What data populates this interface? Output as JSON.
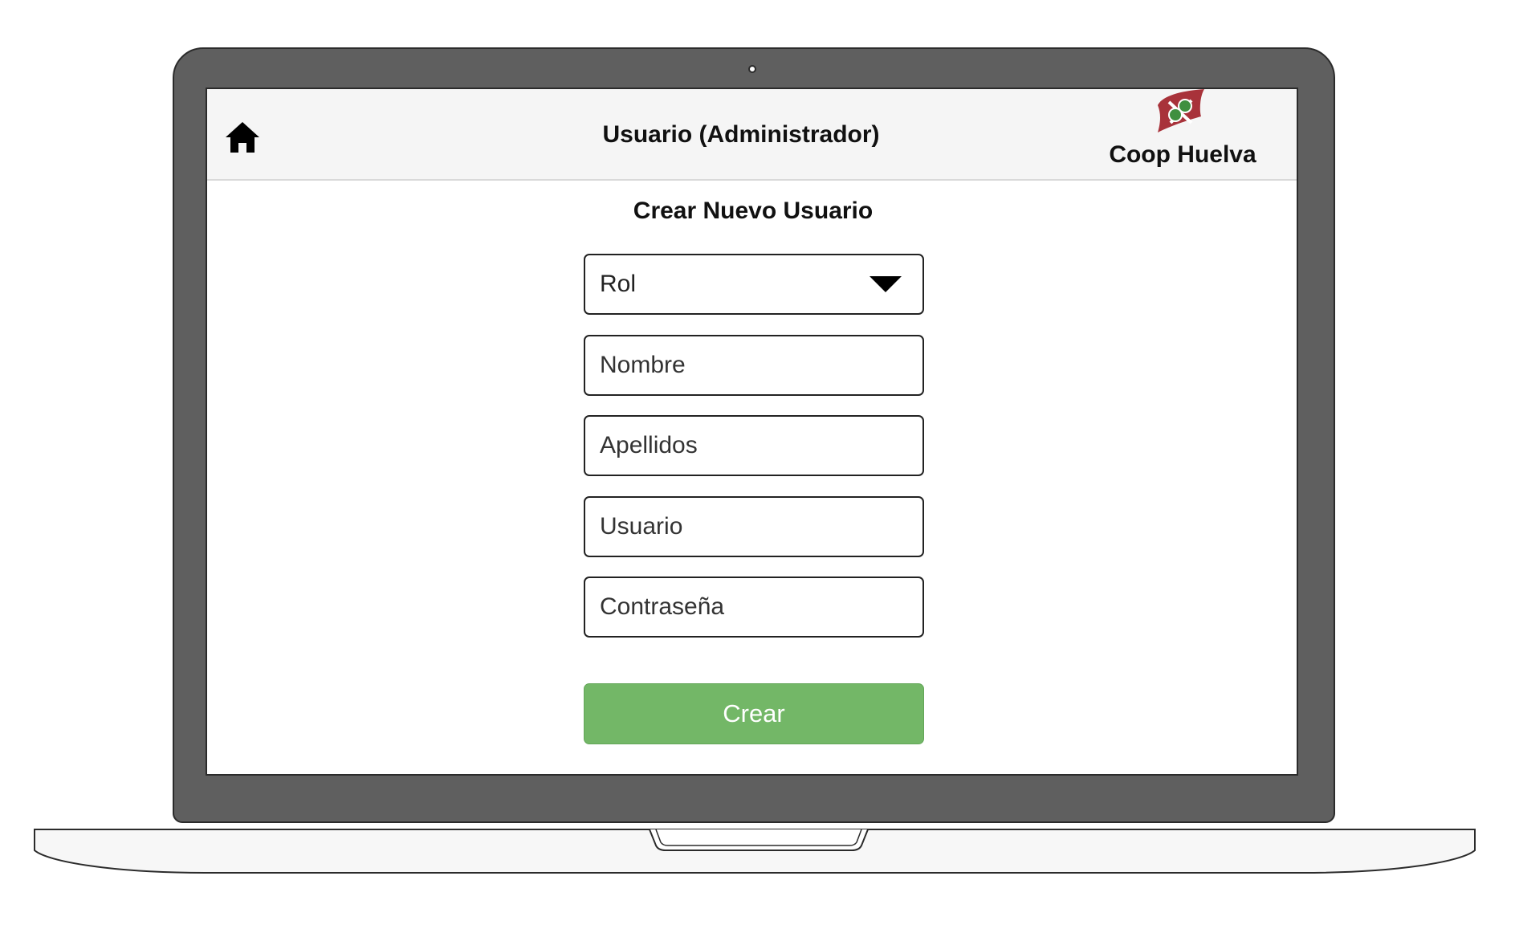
{
  "header": {
    "title": "Usuario (Administrador)",
    "brand_name": "Coop Huelva",
    "home_icon": "home-icon",
    "logo_icon": "coop-huelva-logo"
  },
  "form": {
    "title": "Crear Nuevo Usuario",
    "role_select": {
      "selected": "Rol",
      "icon": "caret-down-icon"
    },
    "fields": {
      "nombre_placeholder": "Nombre",
      "apellidos_placeholder": "Apellidos",
      "usuario_placeholder": "Usuario",
      "password_placeholder": "Contraseña"
    },
    "submit_label": "Crear"
  },
  "colors": {
    "primary_button": "#73b767",
    "logo_red": "#a8323a",
    "logo_green": "#3f8f3f",
    "header_bg": "#f5f5f5",
    "device_frame": "#5f5f5f"
  }
}
